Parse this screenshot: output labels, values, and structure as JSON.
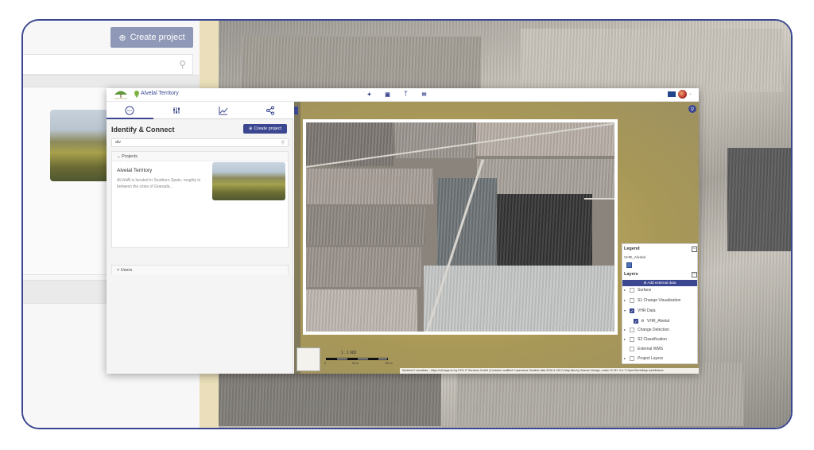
{
  "background_app": {
    "create_project_label": "Create project"
  },
  "topbar": {
    "site_title": "Alvelal Territory"
  },
  "sidebar": {
    "panel_title": "Identify & Connect",
    "create_project_label": "Create project",
    "search_value": "alv",
    "projects_header": "Projects",
    "project": {
      "name": "Alvelal Territory",
      "description": "ALVelAl is located in Southern Spain, roughly in between the cities of Granada..."
    },
    "users_header": "Users"
  },
  "map": {
    "scale_ratio": "1 : 1 982",
    "scale_ticks": [
      "0",
      "50 m",
      "100 m"
    ],
    "attribution": "Sentinel-2 cloudless – https://s2maps.eu by EOX IT Services GmbH (Contains modified Copernicus Sentinel data 2016 & 2017) Map tiles by Stamen Design, under CC BY 3.0. © OpenStreetMap contributors"
  },
  "legend": {
    "title": "Legend",
    "entry": "VHR_Alvelal",
    "layers_title": "Layers",
    "add_external": "Add external data",
    "layers": [
      {
        "label": "Surface",
        "checked": false,
        "expandable": true
      },
      {
        "label": "S1 Change Visualization",
        "checked": false,
        "expandable": true
      },
      {
        "label": "VHR Data",
        "checked": true,
        "expandable": true
      },
      {
        "label": "VHR_Alvelal",
        "checked": true,
        "expandable": false,
        "child": true
      },
      {
        "label": "Change Detection",
        "checked": false,
        "expandable": true
      },
      {
        "label": "S2 Classification",
        "checked": false,
        "expandable": true
      },
      {
        "label": "External WMS",
        "checked": false,
        "expandable": false
      },
      {
        "label": "Project Layers",
        "checked": false,
        "expandable": true
      }
    ]
  },
  "colors": {
    "accent": "#3b4790",
    "frame": "#3b4790"
  }
}
